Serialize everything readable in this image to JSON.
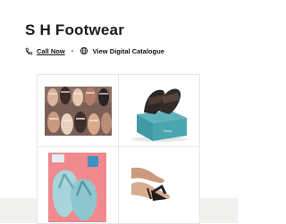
{
  "store": {
    "name": "S H Footwear"
  },
  "actions": {
    "call_label": "Call Now",
    "catalogue_label": "View Digital Catalogue",
    "call_icon": "phone-icon",
    "catalogue_icon": "globe-icon"
  },
  "gallery": {
    "items": [
      {
        "subject": "assorted-sandals-photo"
      },
      {
        "subject": "slides-on-shoebox-photo"
      },
      {
        "subject": "flip-flops-photo"
      },
      {
        "subject": "sandal-on-foot-photo"
      }
    ]
  },
  "colors": {
    "text": "#1b1b1b",
    "border": "#e6e6e6",
    "footer_band": "#f1f1ef",
    "box_teal": "#3f9aa3",
    "pink_bg": "#f08a8e",
    "flipflop_blue": "#8fc7cf"
  }
}
